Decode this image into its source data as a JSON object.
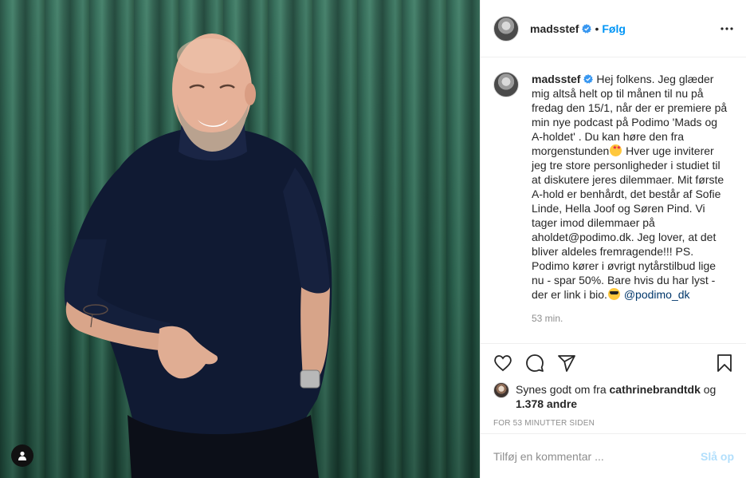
{
  "account": {
    "username": "madsstef",
    "verified": true,
    "separator": "•",
    "follow_label": "Følg"
  },
  "caption": {
    "username": "madsstef",
    "text_1": "Hej folkens. Jeg glæder mig altså helt op til månen til nu på fredag den 15/1, når der er premiere på min nye podcast på Podimo 'Mads og A-holdet' . Du kan høre den fra morgenstunden",
    "emoji_1": "star-struck-emoji",
    "text_2": " Hver uge inviterer jeg tre store personligheder i studiet til at diskutere jeres dilemmaer. Mit første A-hold er benhårdt, det består af Sofie Linde, Hella Joof og Søren Pind. Vi tager imod dilemmaer på aholdet@podimo.dk. Jeg lover, at det bliver aldeles fremragende!!! PS. Podimo kører i øvrigt nytårstilbud lige nu - spar 50%. Bare hvis du har lyst - der er link i bio.",
    "emoji_2": "sunglasses-emoji",
    "mention": "@podimo_dk",
    "time_ago": "53 min."
  },
  "likes": {
    "prefix": "Synes godt om fra ",
    "user": "cathrinebrandtdk",
    "middle": " og",
    "others": "1.378 andre"
  },
  "post_time": "FOR 53 MINUTTER SIDEN",
  "comment_box": {
    "placeholder": "Tilføj en kommentar ...",
    "post_label": "Slå op"
  },
  "icons": {
    "more": "more-options-icon",
    "like": "heart-icon",
    "comment": "comment-icon",
    "share": "share-icon",
    "save": "bookmark-icon",
    "tagged_users": "user-tag-icon"
  },
  "colors": {
    "accent": "#0095f6",
    "mention": "#00376b",
    "muted": "#8e8e8e",
    "post_disabled": "#b2dffc",
    "curtain": "#2f6a55"
  }
}
